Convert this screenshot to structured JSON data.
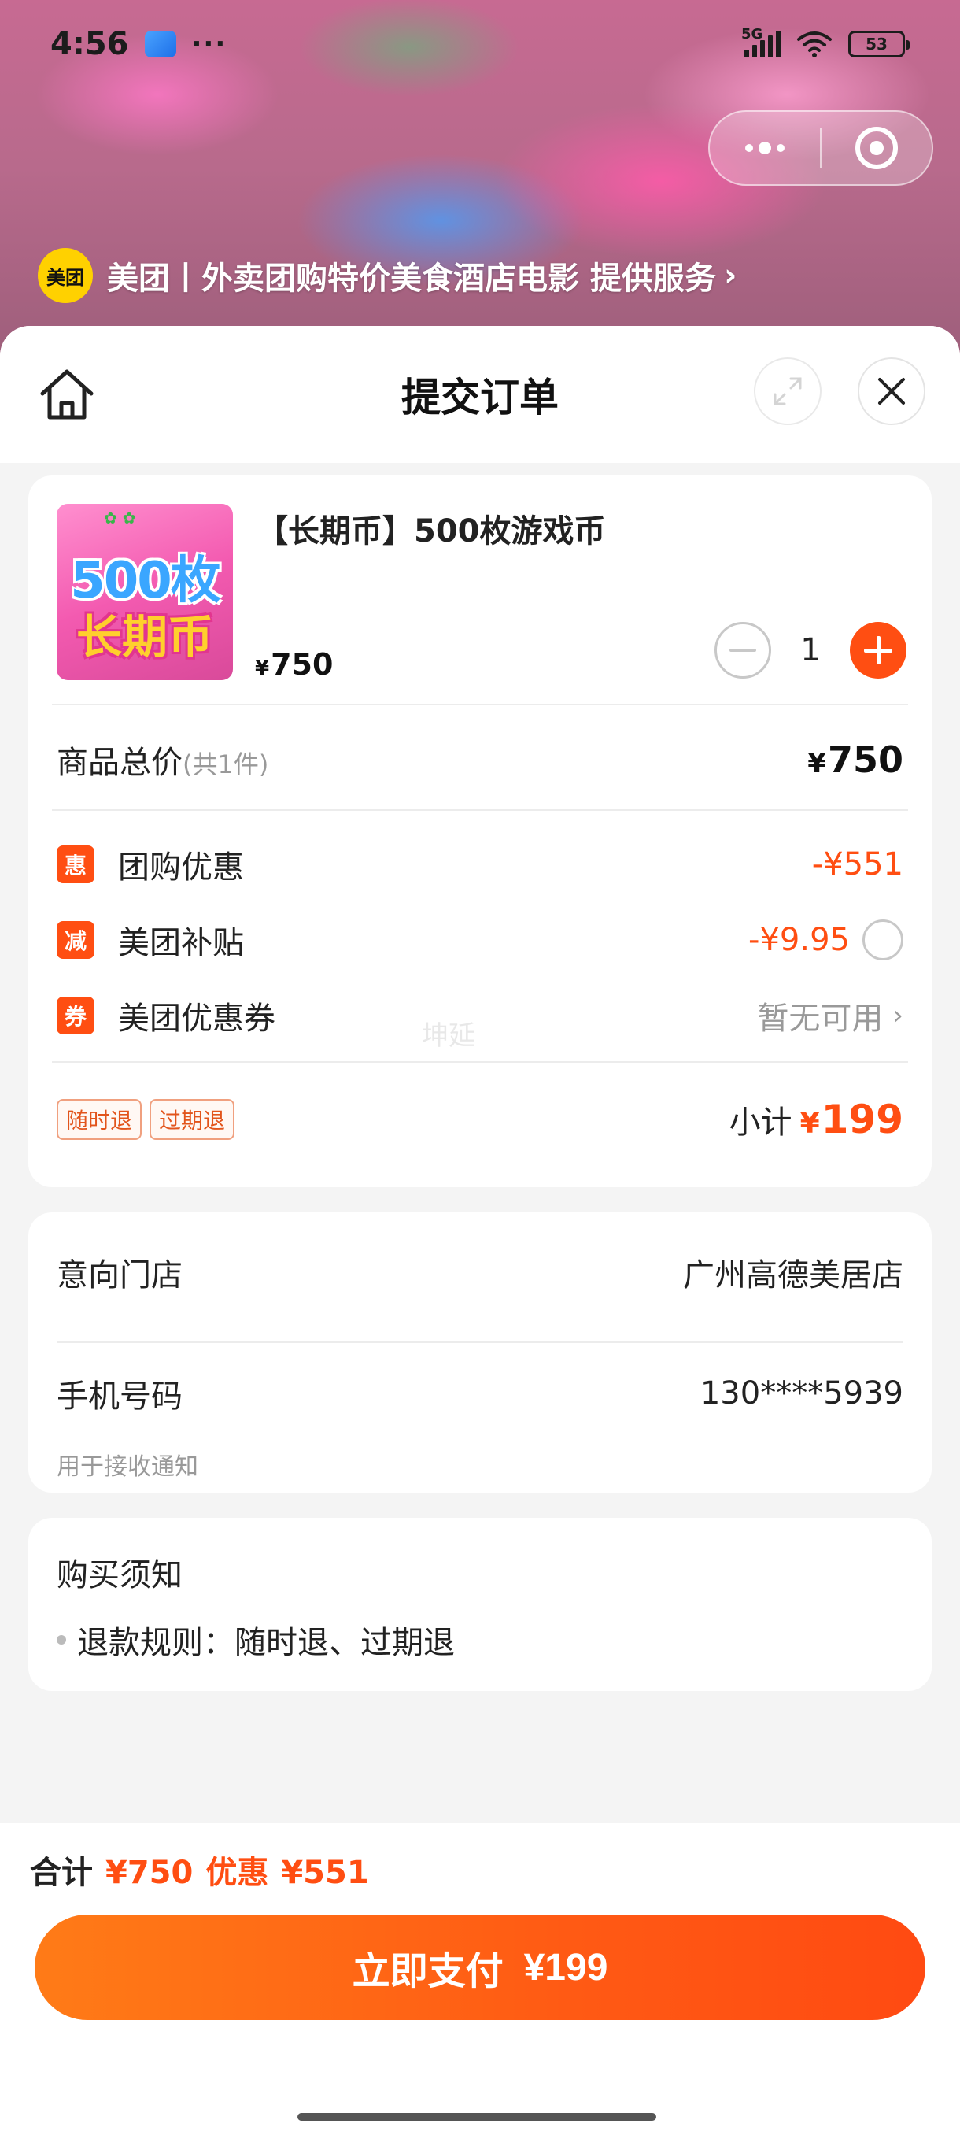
{
  "status_bar": {
    "time": "4:56",
    "dots": "···",
    "network": "5G",
    "battery": "53"
  },
  "provider": {
    "logo_text": "美团",
    "text": "美团丨外卖团购特价美食酒店电影 提供服务",
    "chevron": "›"
  },
  "header": {
    "title": "提交订单"
  },
  "product": {
    "image_text_top": "500枚",
    "image_text_bottom": "长期币",
    "title": "【长期币】500枚游戏币",
    "currency": "¥",
    "price": "750",
    "quantity": "1"
  },
  "pricing": {
    "total_label": "商品总价",
    "total_count": "(共1件)",
    "total_currency": "¥",
    "total_value": "750",
    "discounts": [
      {
        "tag": "惠",
        "label": "团购优惠",
        "value": "-¥551"
      },
      {
        "tag": "减",
        "label": "美团补贴",
        "value": "-¥9.95",
        "selected": false
      },
      {
        "tag": "券",
        "label": "美团优惠券",
        "value": "暂无可用"
      }
    ],
    "watermark": "坤延",
    "badges": [
      "随时退",
      "过期退"
    ],
    "subtotal_label": "小计",
    "subtotal_currency": "¥",
    "subtotal_value": "199"
  },
  "store": {
    "store_label": "意向门店",
    "store_value": "广州高德美居店",
    "phone_label": "手机号码",
    "phone_value": "130****5939",
    "phone_hint": "用于接收通知"
  },
  "notice": {
    "title": "购买须知",
    "item": "退款规则：随时退、过期退"
  },
  "bottom": {
    "sum_label": "合计",
    "sum_value": "¥750",
    "discount_label": "优惠",
    "discount_value": "¥551",
    "pay_label": "立即支付",
    "pay_value": "¥199"
  },
  "colors": {
    "accent": "#ff4e12",
    "pay_gradient_start": "#ff7b17",
    "brand_yellow": "#ffd100"
  }
}
